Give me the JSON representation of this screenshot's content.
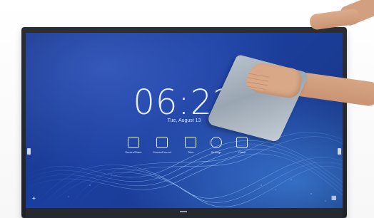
{
  "screen": {
    "time": "06:22",
    "date": "Tue, August 13"
  },
  "dock": {
    "apps": [
      {
        "label": "ScreenShare",
        "icon": "screen-share-icon"
      },
      {
        "label": "ScreenCorrect",
        "icon": "multi-screen-icon"
      },
      {
        "label": "Files",
        "icon": "folder-icon"
      },
      {
        "label": "Settings",
        "icon": "gear-icon"
      },
      {
        "label": "Class",
        "icon": "calendar-icon"
      }
    ]
  },
  "colors": {
    "screen_blue": "#1b3fa0",
    "bezel": "#2b2e33",
    "skin": "#d9a886",
    "cloth": "#aeb8c3"
  }
}
